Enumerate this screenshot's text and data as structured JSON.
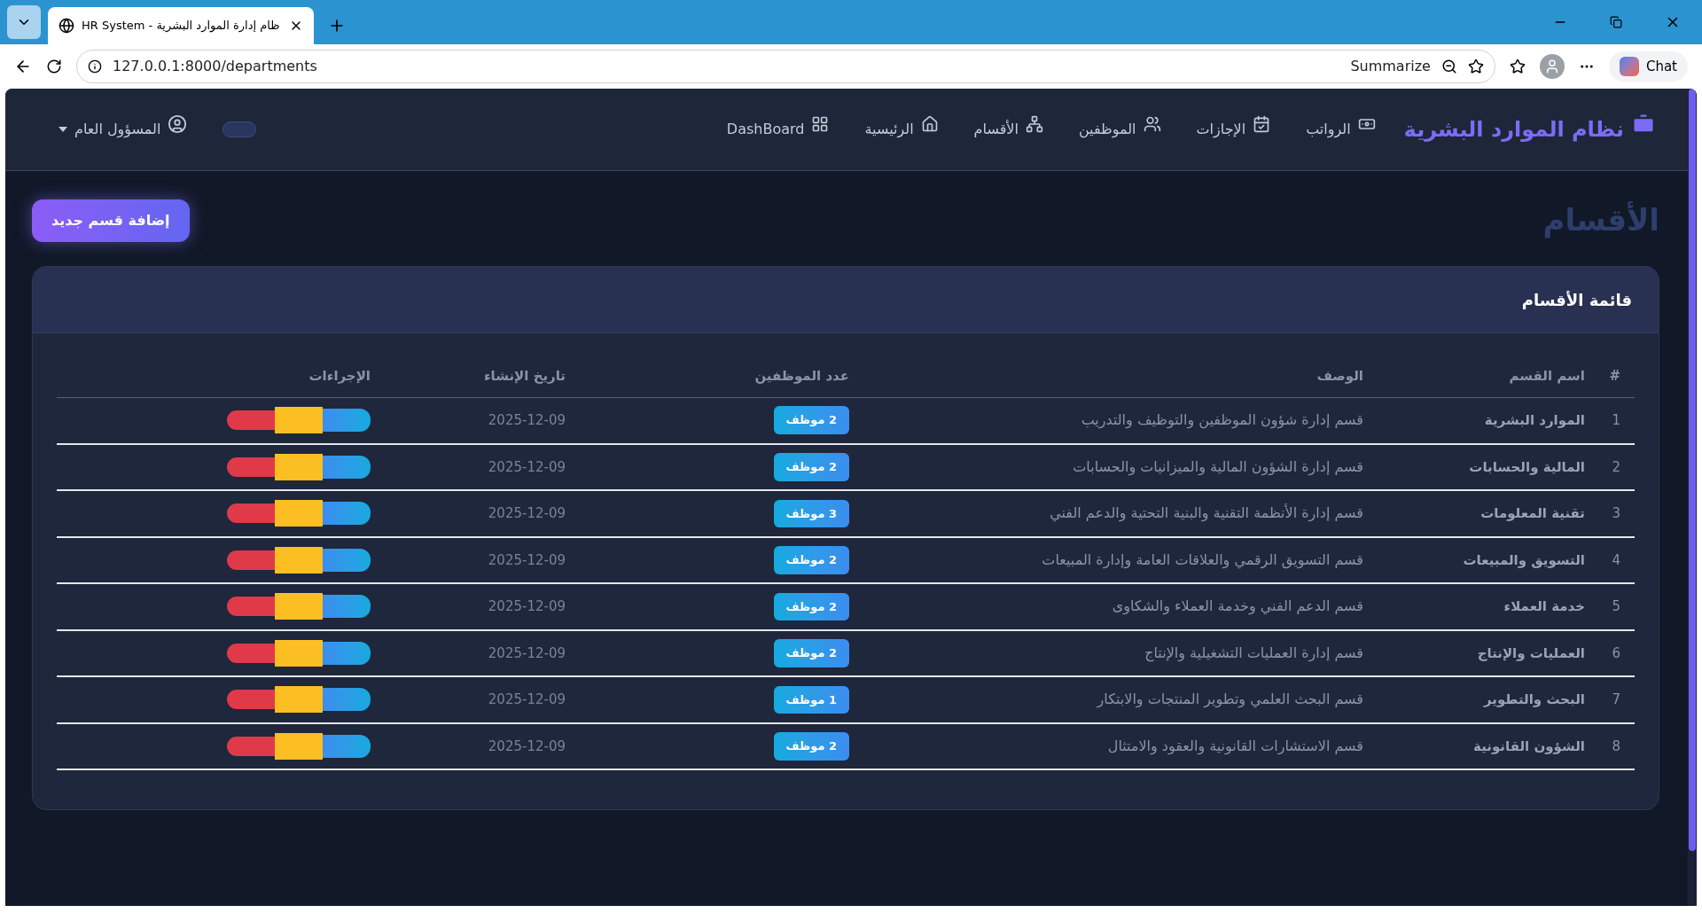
{
  "browser": {
    "tab_title": "HR System - ظام إدارة الموارد البشرية",
    "url": "127.0.0.1:8000/departments",
    "summarize": "Summarize",
    "chat": "Chat"
  },
  "navbar": {
    "brand": "نظام الموارد البشرية",
    "items": [
      {
        "label": "الرواتب"
      },
      {
        "label": "الإجازات"
      },
      {
        "label": "الموظفين"
      },
      {
        "label": "الأقسام"
      },
      {
        "label": "الرئيسية"
      },
      {
        "label": "DashBoard"
      }
    ],
    "theme_toggle": {
      "on": false
    },
    "user": "المسؤول العام"
  },
  "page": {
    "title": "الأقسام",
    "add_button": "إضافة قسم جديد"
  },
  "card": {
    "title": "قائمة الأقسام"
  },
  "table": {
    "columns": [
      "#",
      "اسم القسم",
      "الوصف",
      "عدد الموظفين",
      "تاريخ الإنشاء",
      "الإجراءات"
    ],
    "rows": [
      {
        "num": "1",
        "name": "الموارد البشرية",
        "description": "قسم إدارة شؤون الموظفين والتوظيف والتدريب",
        "employees": "2 موظف",
        "created": "2025-12-09"
      },
      {
        "num": "2",
        "name": "المالية والحسابات",
        "description": "قسم إدارة الشؤون المالية والميزانيات والحسابات",
        "employees": "2 موظف",
        "created": "2025-12-09"
      },
      {
        "num": "3",
        "name": "تقنية المعلومات",
        "description": "قسم إدارة الأنظمة التقنية والبنية التحتية والدعم الفني",
        "employees": "3 موظف",
        "created": "2025-12-09"
      },
      {
        "num": "4",
        "name": "التسويق والمبيعات",
        "description": "قسم التسويق الرقمي والعلاقات العامة وإدارة المبيعات",
        "employees": "2 موظف",
        "created": "2025-12-09"
      },
      {
        "num": "5",
        "name": "خدمة العملاء",
        "description": "قسم الدعم الفني وخدمة العملاء والشكاوى",
        "employees": "2 موظف",
        "created": "2025-12-09"
      },
      {
        "num": "6",
        "name": "العمليات والإنتاج",
        "description": "قسم إدارة العمليات التشغيلية والإنتاج",
        "employees": "2 موظف",
        "created": "2025-12-09"
      },
      {
        "num": "7",
        "name": "البحث والتطوير",
        "description": "قسم البحث العلمي وتطوير المنتجات والابتكار",
        "employees": "1 موظف",
        "created": "2025-12-09"
      },
      {
        "num": "8",
        "name": "الشؤون القانونية",
        "description": "قسم الاستشارات القانونية والعقود والامتثال",
        "employees": "2 موظف",
        "created": "2025-12-09"
      }
    ]
  }
}
